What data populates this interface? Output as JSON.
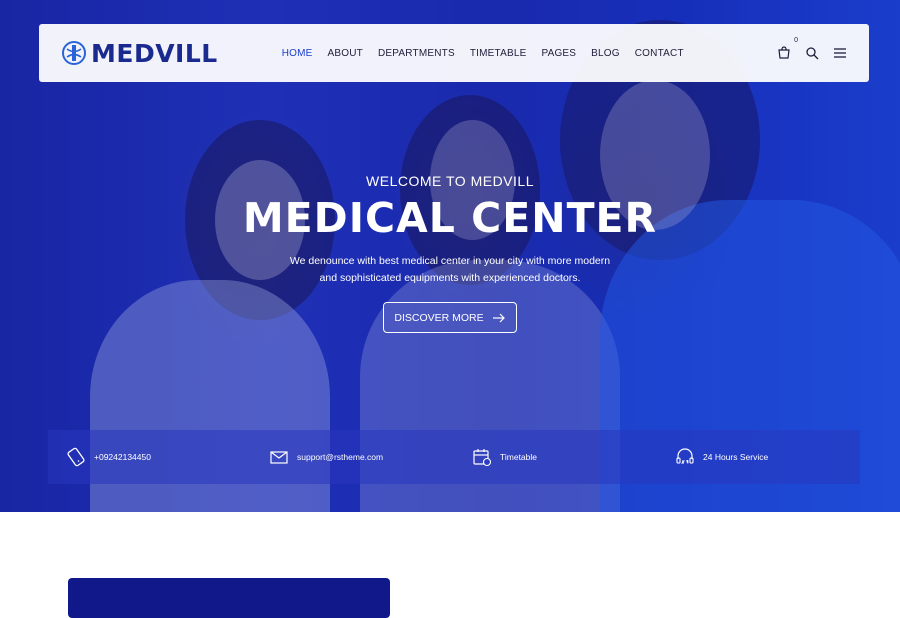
{
  "brand": {
    "name": "MEDVILL",
    "color": "#1a2a8e"
  },
  "nav": {
    "items": [
      {
        "label": "HOME",
        "active": true
      },
      {
        "label": "ABOUT",
        "active": false
      },
      {
        "label": "DEPARTMENTS",
        "active": false
      },
      {
        "label": "TIMETABLE",
        "active": false
      },
      {
        "label": "PAGES",
        "active": false
      },
      {
        "label": "BLOG",
        "active": false
      },
      {
        "label": "CONTACT",
        "active": false
      }
    ],
    "cart_count": "0",
    "icons": [
      "cart-icon",
      "search-icon",
      "menu-icon"
    ]
  },
  "hero": {
    "welcome": "WELCOME TO MEDVILL",
    "headline": "MEDICAL CENTER",
    "description_line1": "We denounce with best medical center in your city with more modern",
    "description_line2": "and sophisticated equipments with experienced doctors.",
    "cta_label": "DISCOVER MORE"
  },
  "info_bar": [
    {
      "icon": "phone-icon",
      "text": "+09242134450"
    },
    {
      "icon": "email-icon",
      "text": "support@rstheme.com"
    },
    {
      "icon": "calendar-icon",
      "text": "Timetable"
    },
    {
      "icon": "support-24-icon",
      "text": "24 Hours Service"
    }
  ],
  "colors": {
    "accent": "#1a3fc9",
    "hero_overlay": "#2338c4",
    "card": "#10188a"
  }
}
